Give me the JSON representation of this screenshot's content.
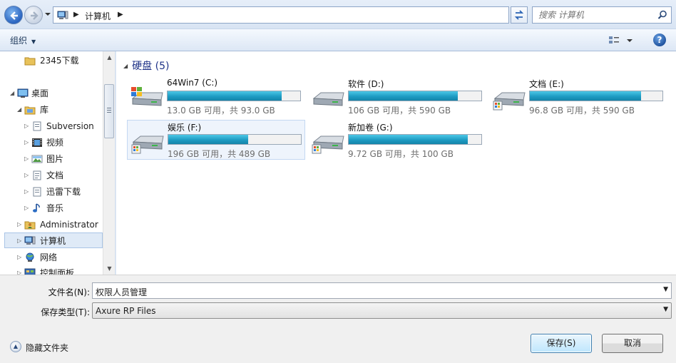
{
  "address": {
    "breadcrumb": [
      "计算机"
    ],
    "search_placeholder": "搜索 计算机"
  },
  "toolbar": {
    "organize_label": "组织",
    "help_label": "?"
  },
  "nav": {
    "items": [
      {
        "label": "2345下载",
        "icon": "folder-icon"
      },
      {
        "label": "桌面",
        "icon": "desktop-icon"
      },
      {
        "label": "库",
        "icon": "library-icon"
      },
      {
        "label": "Subversion",
        "icon": "document-library-icon"
      },
      {
        "label": "视频",
        "icon": "video-icon"
      },
      {
        "label": "图片",
        "icon": "picture-icon"
      },
      {
        "label": "文档",
        "icon": "document-icon"
      },
      {
        "label": "迅雷下载",
        "icon": "document-library-icon"
      },
      {
        "label": "音乐",
        "icon": "music-icon"
      },
      {
        "label": "Administrator",
        "icon": "user-icon"
      },
      {
        "label": "计算机",
        "icon": "computer-icon"
      },
      {
        "label": "网络",
        "icon": "network-icon"
      },
      {
        "label": "控制面板",
        "icon": "control-panel-icon"
      }
    ]
  },
  "content": {
    "group_label": "硬盘 (5)",
    "drives": [
      {
        "name": "64Win7  (C:)",
        "info": "13.0 GB 可用，共 93.0 GB",
        "used_fraction": 0.86,
        "icon": "windows-drive-icon"
      },
      {
        "name": "软件 (D:)",
        "info": "106 GB 可用，共 590 GB",
        "used_fraction": 0.82,
        "icon": "hard-drive-icon"
      },
      {
        "name": "文档 (E:)",
        "info": "96.8 GB 可用，共 590 GB",
        "used_fraction": 0.84,
        "icon": "hard-drive-icon"
      },
      {
        "name": "娱乐 (F:)",
        "info": "196 GB 可用，共 489 GB",
        "used_fraction": 0.6,
        "icon": "hard-drive-icon"
      },
      {
        "name": "新加卷 (G:)",
        "info": "9.72 GB 可用，共 100 GB",
        "used_fraction": 0.9,
        "icon": "hard-drive-icon"
      }
    ]
  },
  "bottom": {
    "filename_label": "文件名(N):",
    "filename_value": "权限人员管理",
    "filetype_label": "保存类型(T):",
    "filetype_value": "Axure RP Files",
    "hide_folders_label": "隐藏文件夹",
    "save_label": "保存(S)",
    "cancel_label": "取消"
  }
}
